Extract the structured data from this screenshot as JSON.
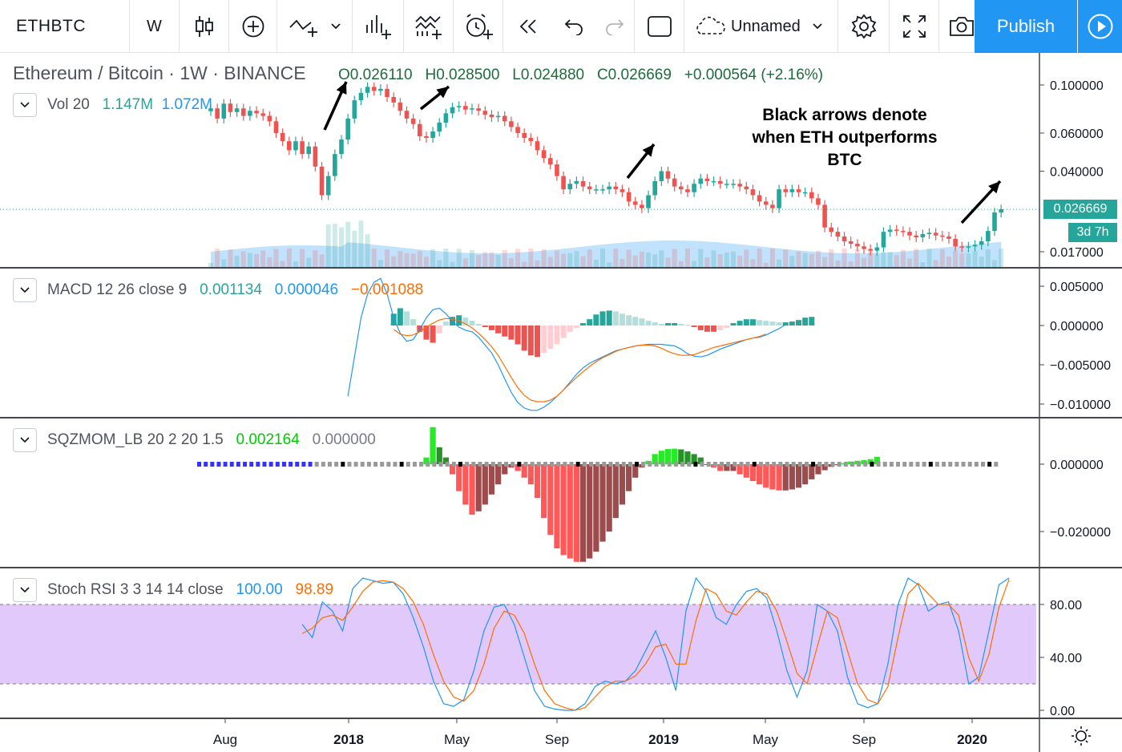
{
  "toolbar": {
    "symbol": "ETHBTC",
    "interval": "W",
    "layout_name": "Unnamed",
    "publish_label": "Publish",
    "icons": [
      "candles-icon",
      "add-circle-icon",
      "indicators-icon",
      "chevron-down-icon",
      "compare-icon",
      "templates-icon",
      "alert-icon",
      "replay-icon",
      "undo-icon",
      "redo-icon",
      "fullscreen-box-icon",
      "cloud-icon",
      "settings-icon",
      "expand-icon",
      "camera-icon",
      "play-icon"
    ]
  },
  "header": {
    "title": "Ethereum / Bitcoin · 1W · BINANCE",
    "open": "O0.026110",
    "high": "H0.028500",
    "low": "L0.024880",
    "close": "C0.026669",
    "change": "+0.000564 (+2.16%)"
  },
  "colors": {
    "up": "#26a69a",
    "down": "#ef5350",
    "macd": "#2196f3",
    "signal": "#ff6d00",
    "stoch_band": "#e1c9fb",
    "sqz_up_bright": "#00e600",
    "sqz_down_bright": "#ff1f1f"
  },
  "panes": {
    "vol": {
      "label": "Vol 20",
      "v1": "1.147M",
      "v2": "1.072M"
    },
    "macd": {
      "label": "MACD 12 26 close 9",
      "v1": "0.001134",
      "v2": "0.000046",
      "v3": "−0.001088"
    },
    "sqz": {
      "label": "SQZMOM_LB 20 2 20 1.5",
      "v1": "0.002164",
      "v2": "0.000000"
    },
    "stoch": {
      "label": "Stoch RSI 3 3 14 14 close",
      "v1": "100.00",
      "v2": "98.89"
    }
  },
  "price_label": {
    "value": "0.026669",
    "countdown": "3d 7h"
  },
  "annotation": {
    "line1": "Black arrows denote",
    "line2": "when ETH outperforms",
    "line3": "BTC"
  },
  "chart_data": [
    {
      "type": "candlestick",
      "title": "Ethereum / Bitcoin · 1W · BINANCE",
      "y_scale": "log",
      "y_ticks": [
        "0.100000",
        "0.060000",
        "0.040000",
        "0.017000"
      ],
      "x_ticks": [
        "Aug",
        "2018",
        "May",
        "Sep",
        "2019",
        "May",
        "Sep",
        "2020"
      ],
      "grid": false,
      "closes": [
        0.078,
        0.07,
        0.082,
        0.075,
        0.078,
        0.072,
        0.076,
        0.074,
        0.072,
        0.068,
        0.06,
        0.055,
        0.05,
        0.055,
        0.048,
        0.052,
        0.042,
        0.031,
        0.038,
        0.048,
        0.056,
        0.07,
        0.085,
        0.092,
        0.098,
        0.094,
        0.096,
        0.088,
        0.083,
        0.076,
        0.07,
        0.066,
        0.058,
        0.057,
        0.061,
        0.067,
        0.074,
        0.079,
        0.08,
        0.077,
        0.078,
        0.076,
        0.073,
        0.071,
        0.072,
        0.068,
        0.064,
        0.06,
        0.057,
        0.055,
        0.05,
        0.046,
        0.043,
        0.038,
        0.033,
        0.035,
        0.036,
        0.034,
        0.033,
        0.033,
        0.033,
        0.034,
        0.033,
        0.032,
        0.029,
        0.028,
        0.027,
        0.031,
        0.036,
        0.04,
        0.037,
        0.034,
        0.033,
        0.032,
        0.035,
        0.037,
        0.036,
        0.036,
        0.035,
        0.035,
        0.035,
        0.034,
        0.033,
        0.031,
        0.029,
        0.028,
        0.027,
        0.033,
        0.032,
        0.033,
        0.032,
        0.032,
        0.03,
        0.028,
        0.022,
        0.021,
        0.02,
        0.019,
        0.0185,
        0.018,
        0.0175,
        0.0172,
        0.0178,
        0.021,
        0.0215,
        0.0212,
        0.021,
        0.0202,
        0.0198,
        0.0205,
        0.0208,
        0.0202,
        0.02,
        0.0195,
        0.018,
        0.0178,
        0.018,
        0.0183,
        0.019,
        0.0212,
        0.0258,
        0.0267
      ],
      "volume_series": [
        "Vol 20"
      ],
      "last_price": "0.026669"
    },
    {
      "type": "line",
      "title": "MACD 12 26 close 9",
      "y_ticks": [
        "0.005000",
        "0.000000",
        "−0.005000",
        "−0.010000"
      ],
      "series": [
        {
          "name": "MACD",
          "color": "#2196f3"
        },
        {
          "name": "Signal",
          "color": "#ff6d00"
        }
      ],
      "macd": [
        -0.009,
        -0.004,
        0.001,
        0.004,
        0.0055,
        0.006,
        0.004,
        0.001,
        -0.001,
        -0.002,
        -0.0018,
        -0.0005,
        0.001,
        0.002,
        0.0022,
        0.0015,
        0.0005,
        -0.0002,
        -0.0006,
        -0.0008,
        -0.0015,
        -0.0025,
        -0.0035,
        -0.005,
        -0.0068,
        -0.0085,
        -0.0098,
        -0.0105,
        -0.0108,
        -0.0108,
        -0.0104,
        -0.0098,
        -0.009,
        -0.0082,
        -0.0072,
        -0.0062,
        -0.0054,
        -0.0048,
        -0.0044,
        -0.004,
        -0.0036,
        -0.0032,
        -0.003,
        -0.0028,
        -0.0026,
        -0.0025,
        -0.0024,
        -0.0024,
        -0.0024,
        -0.0025,
        -0.0026,
        -0.003,
        -0.0036,
        -0.0039,
        -0.004,
        -0.0038,
        -0.0034,
        -0.003,
        -0.0027,
        -0.0024,
        -0.0021,
        -0.0018,
        -0.0016,
        -0.0015,
        -0.0012,
        -0.0008,
        -0.0004,
        0.0001
      ],
      "signal": [
        null,
        null,
        null,
        null,
        null,
        null,
        null,
        -0.0005,
        -0.0011,
        -0.0013,
        -0.0012,
        -0.0008,
        -0.0002,
        0.0003,
        0.0007,
        0.0009,
        0.0008,
        0.0006,
        0.0002,
        -0.0003,
        -0.001,
        -0.0018,
        -0.0027,
        -0.0038,
        -0.0052,
        -0.0066,
        -0.0079,
        -0.0089,
        -0.0095,
        -0.0097,
        -0.0097,
        -0.0095,
        -0.009,
        -0.0082,
        -0.0074,
        -0.0066,
        -0.0059,
        -0.0052,
        -0.0046,
        -0.0041,
        -0.0037,
        -0.0033,
        -0.003,
        -0.0028,
        -0.0026,
        -0.0025,
        -0.0025,
        -0.0026,
        -0.0029,
        -0.0033,
        -0.0036,
        -0.0038,
        -0.0038,
        -0.0037,
        -0.0034,
        -0.0031,
        -0.0028,
        -0.0026,
        -0.0024,
        -0.0022,
        -0.002,
        -0.0018,
        -0.0016,
        -0.0014,
        -0.0011
      ],
      "histogram": [
        0.0015,
        0.0022,
        0.0018,
        0.0008,
        -0.0008,
        -0.0018,
        -0.0022,
        -0.001,
        0.0005,
        0.0011,
        0.0013,
        0.001,
        0.0006,
        0.0002,
        -0.0002,
        -0.0006,
        -0.001,
        -0.0014,
        -0.0018,
        -0.0024,
        -0.0032,
        -0.0038,
        -0.004,
        -0.0035,
        -0.003,
        -0.0024,
        -0.0016,
        -0.0008,
        -0.0003,
        0.0003,
        0.0008,
        0.0014,
        0.0018,
        0.0019,
        0.0018,
        0.0015,
        0.0013,
        0.0011,
        0.0009,
        0.0006,
        0.0004,
        0.0002,
        0.0003,
        0.0003,
        0.0002,
        0.0001,
        -0.0002,
        -0.0006,
        -0.0008,
        -0.0008,
        -0.0006,
        -0.0003,
        0.0003,
        0.0006,
        0.0008,
        0.0008,
        0.0007,
        0.0006,
        0.0005,
        0.0004,
        0.0004,
        0.0005,
        0.0007,
        0.001,
        0.0011
      ]
    },
    {
      "type": "bar",
      "title": "SQZMOM_LB 20 2 20 1.5",
      "y_ticks": [
        "0.000000",
        "−0.020000"
      ],
      "values": [
        0.002,
        0.011,
        0.005,
        0.002,
        -0.003,
        -0.008,
        -0.012,
        -0.015,
        -0.014,
        -0.012,
        -0.009,
        -0.006,
        -0.003,
        -0.001,
        -0.002,
        -0.004,
        -0.006,
        -0.01,
        -0.016,
        -0.021,
        -0.025,
        -0.027,
        -0.028,
        -0.029,
        -0.029,
        -0.028,
        -0.026,
        -0.023,
        -0.02,
        -0.016,
        -0.012,
        -0.008,
        -0.004,
        -0.001,
        0.001,
        0.003,
        0.004,
        0.0045,
        0.0046,
        0.0044,
        0.0038,
        0.003,
        0.002,
        0.0,
        -0.001,
        -0.002,
        -0.002,
        -0.002,
        -0.003,
        -0.004,
        -0.005,
        -0.006,
        -0.007,
        -0.0075,
        -0.0078,
        -0.0078,
        -0.0075,
        -0.007,
        -0.006,
        -0.0045,
        -0.003,
        -0.0018,
        -0.0008,
        -0.0003,
        0.0003,
        0.0008,
        0.001,
        0.0012,
        0.0015,
        0.0022
      ]
    },
    {
      "type": "line",
      "title": "Stoch RSI 3 3 14 14 close",
      "y_ticks": [
        "80.00",
        "40.00",
        "0.00"
      ],
      "band": [
        20,
        80
      ],
      "series": [
        {
          "name": "K",
          "color": "#2196f3"
        },
        {
          "name": "D",
          "color": "#ff6d00"
        }
      ],
      "k": [
        65,
        55,
        82,
        75,
        60,
        92,
        100,
        98,
        96,
        97,
        88,
        70,
        48,
        22,
        5,
        3,
        8,
        30,
        60,
        78,
        80,
        65,
        40,
        15,
        3,
        1,
        0,
        0,
        5,
        18,
        22,
        20,
        22,
        30,
        45,
        60,
        40,
        15,
        75,
        100,
        90,
        70,
        65,
        80,
        90,
        92,
        85,
        60,
        30,
        10,
        30,
        80,
        75,
        60,
        25,
        5,
        2,
        5,
        35,
        80,
        100,
        95,
        75,
        80,
        82,
        60,
        20,
        25,
        60,
        95,
        100
      ],
      "d": [
        58,
        62,
        70,
        72,
        68,
        78,
        90,
        97,
        98,
        97,
        92,
        82,
        65,
        42,
        22,
        10,
        7,
        15,
        35,
        62,
        75,
        72,
        58,
        35,
        15,
        5,
        2,
        0,
        2,
        10,
        18,
        22,
        22,
        26,
        35,
        48,
        50,
        35,
        35,
        68,
        92,
        88,
        75,
        72,
        82,
        90,
        88,
        75,
        52,
        28,
        20,
        48,
        75,
        70,
        45,
        20,
        8,
        5,
        18,
        55,
        88,
        96,
        88,
        80,
        80,
        72,
        40,
        22,
        42,
        78,
        99
      ]
    }
  ]
}
